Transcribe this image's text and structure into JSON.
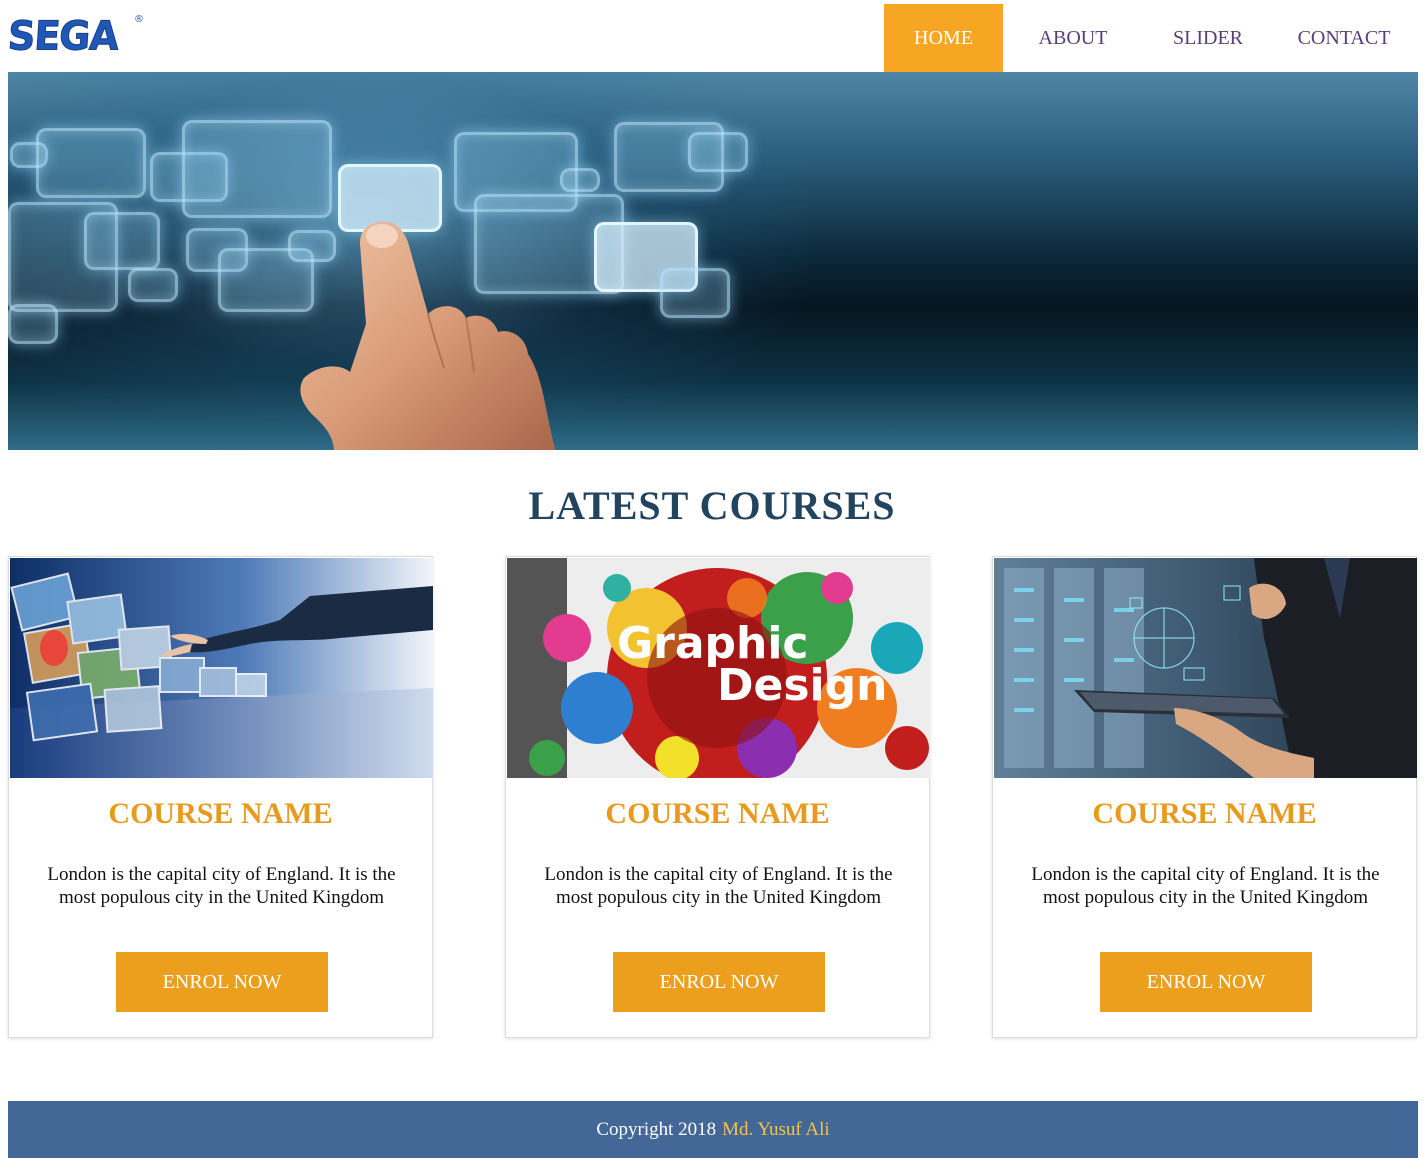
{
  "brand": {
    "logo_text": "SEGA",
    "logo_mark": "®"
  },
  "nav": {
    "items": [
      {
        "label": "HOME",
        "active": true
      },
      {
        "label": "ABOUT",
        "active": false
      },
      {
        "label": "SLIDER",
        "active": false
      },
      {
        "label": "CONTACT",
        "active": false
      }
    ]
  },
  "hero": {
    "image": "hand-touching-glowing-screens-image"
  },
  "courses": {
    "title": "LATEST COURSES",
    "cards": [
      {
        "image": "virtual-reality-screens-image",
        "name": "COURSE NAME",
        "description": "London is the capital city of England. It is the most populous city in the United Kingdom",
        "button": "ENROL NOW"
      },
      {
        "image": "graphic-design-image",
        "image_text_1": "Graphic",
        "image_text_2": "Design",
        "name": "COURSE NAME",
        "description": "London is the capital city of England. It is the most populous city in the United Kingdom",
        "button": "ENROL NOW"
      },
      {
        "image": "businessman-tablet-server-image",
        "name": "COURSE NAME",
        "description": "London is the capital city of England. It is the most populous city in the United Kingdom",
        "button": "ENROL NOW"
      }
    ]
  },
  "footer": {
    "copyright": "Copyright 2018",
    "author": "Md. Yusuf Ali"
  },
  "colors": {
    "accent": "#f7a623",
    "button": "#ec9f1d",
    "course_title": "#e89a1e",
    "section_title": "#23445e",
    "nav_text": "#5a3d7a",
    "footer_bg": "#436796",
    "footer_author": "#f5c542"
  }
}
